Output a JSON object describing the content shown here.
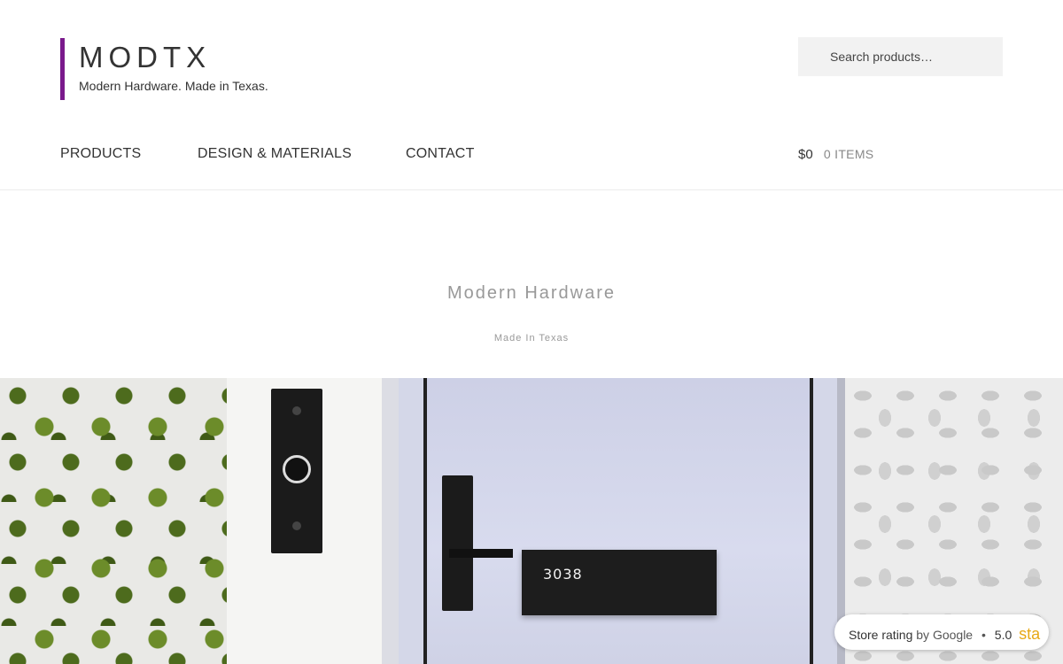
{
  "brand": {
    "title": "MODTX",
    "tagline": "Modern Hardware. Made in Texas.",
    "accent_color": "#7a1a8c"
  },
  "search": {
    "placeholder": "Search products…"
  },
  "nav": {
    "items": [
      {
        "label": "PRODUCTS"
      },
      {
        "label": "DESIGN & MATERIALS"
      },
      {
        "label": "CONTACT"
      }
    ]
  },
  "cart": {
    "amount": "$0",
    "items": "0 ITEMS"
  },
  "hero": {
    "title": "Modern Hardware",
    "subtitle": "Made In Texas",
    "house_number": "3038"
  },
  "rating": {
    "label": "Store rating",
    "source": "by Google",
    "separator": "•",
    "score": "5.0",
    "stars_text": "sta",
    "star_color": "#e7a816"
  }
}
